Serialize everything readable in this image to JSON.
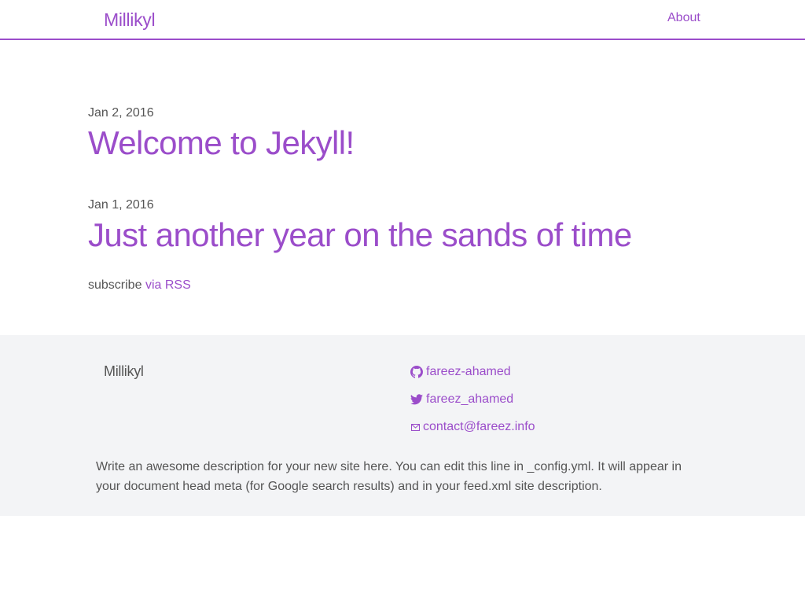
{
  "header": {
    "site_title": "Millikyl",
    "nav": [
      {
        "label": "About"
      }
    ]
  },
  "posts": [
    {
      "date": "Jan 2, 2016",
      "title": "Welcome to Jekyll!"
    },
    {
      "date": "Jan 1, 2016",
      "title": "Just another year on the sands of time"
    }
  ],
  "subscribe": {
    "prefix": "subscribe",
    "link_label": "via RSS"
  },
  "footer": {
    "title": "Millikyl",
    "links": [
      {
        "icon": "github-icon",
        "label": "fareez-ahamed"
      },
      {
        "icon": "twitter-icon",
        "label": "fareez_ahamed"
      },
      {
        "icon": "mail-icon",
        "label": "contact@fareez.info"
      }
    ],
    "description": "Write an awesome description for your new site here. You can edit this line in _config.yml. It will appear in your document head meta (for Google search results) and in your feed.xml site description."
  },
  "colors": {
    "accent": "#9b4dca",
    "text": "#555555",
    "footer_bg": "#f3f4f6"
  }
}
